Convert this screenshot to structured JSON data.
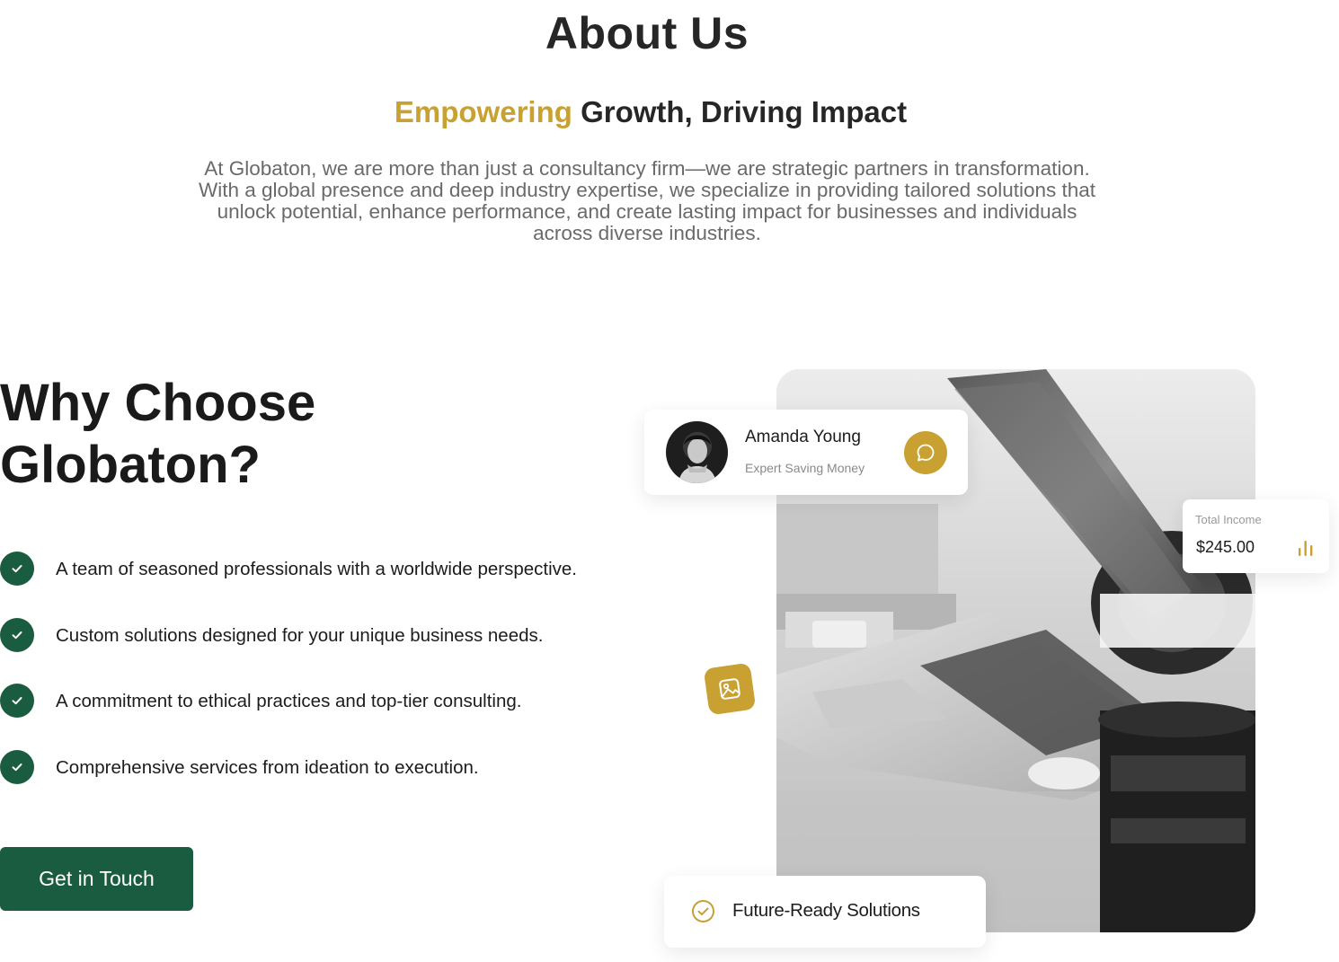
{
  "about": {
    "title": "About Us",
    "subtitle_accent": "Empowering",
    "subtitle_rest": "Growth, Driving Impact",
    "description": "At Globaton, we are more than just a consultancy firm—we are strategic partners in transformation. With a global presence and deep industry expertise, we specialize in providing tailored solutions that unlock potential, enhance performance, and create lasting impact for businesses and individuals across diverse industries."
  },
  "why": {
    "title_line1": "Why Choose",
    "title_line2": "Globaton?",
    "features": [
      "A team of seasoned professionals with a worldwide perspective.",
      "Custom solutions designed for your unique business needs.",
      "A commitment to ethical practices and top-tier consulting.",
      "Comprehensive services from ideation to execution."
    ],
    "cta_label": "Get in Touch"
  },
  "profile_card": {
    "name": "Amanda Young",
    "role": "Expert Saving Money",
    "action_icon": "chat-bubble-icon"
  },
  "income_card": {
    "label": "Total Income",
    "value": "$245.00",
    "icon": "bar-chart-icon"
  },
  "badge_icon": "image-icon",
  "future_card": {
    "label": "Future-Ready Solutions",
    "icon": "check-circle-icon"
  },
  "colors": {
    "accent_gold": "#c9a133",
    "brand_green": "#1a5c3f",
    "heading": "#262626",
    "body_text": "#6a6a6a"
  }
}
